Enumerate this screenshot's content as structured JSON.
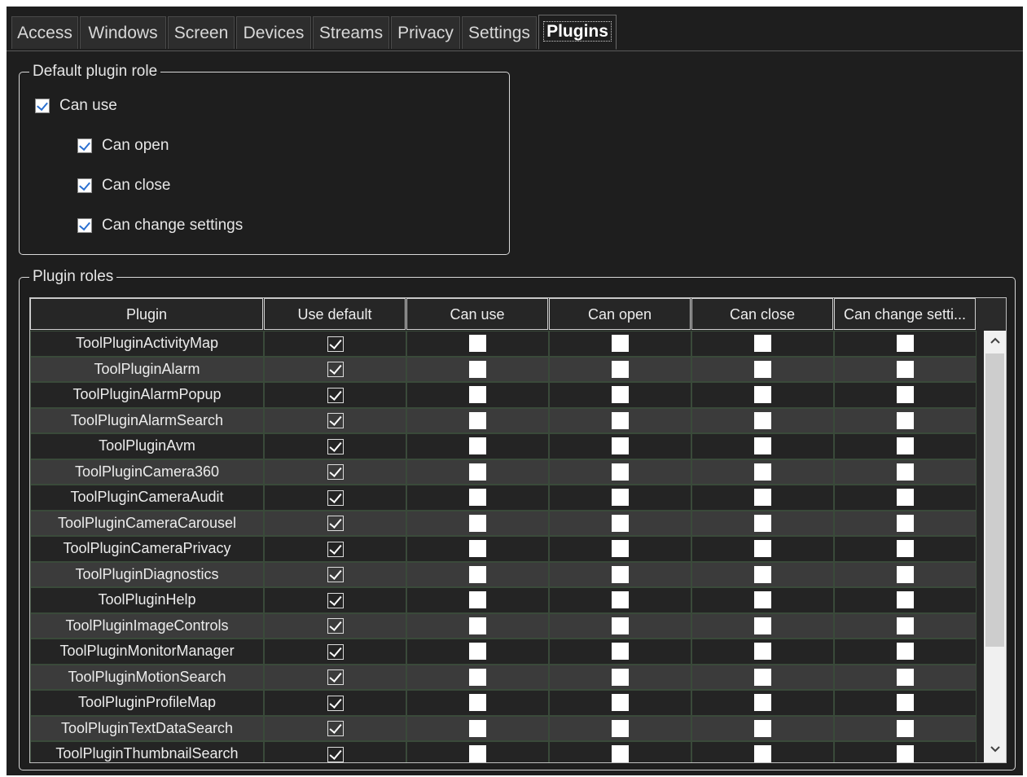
{
  "tabs": [
    {
      "label": "Access",
      "active": false
    },
    {
      "label": "Windows",
      "active": false
    },
    {
      "label": "Screen",
      "active": false
    },
    {
      "label": "Devices",
      "active": false
    },
    {
      "label": "Streams",
      "active": false
    },
    {
      "label": "Privacy",
      "active": false
    },
    {
      "label": "Settings",
      "active": false
    },
    {
      "label": "Plugins",
      "active": true
    }
  ],
  "default_role": {
    "legend": "Default plugin role",
    "can_use": {
      "label": "Can use",
      "checked": true
    },
    "can_open": {
      "label": "Can open",
      "checked": true
    },
    "can_close": {
      "label": "Can close",
      "checked": true
    },
    "can_change_settings": {
      "label": "Can change settings",
      "checked": true
    }
  },
  "plugin_roles": {
    "legend": "Plugin roles",
    "columns": [
      "Plugin",
      "Use default",
      "Can use",
      "Can open",
      "Can close",
      "Can change setti..."
    ],
    "rows": [
      {
        "plugin": "ToolPluginActivityMap",
        "use_default": true,
        "can_use": false,
        "can_open": false,
        "can_close": false,
        "can_change_settings": false
      },
      {
        "plugin": "ToolPluginAlarm",
        "use_default": true,
        "can_use": false,
        "can_open": false,
        "can_close": false,
        "can_change_settings": false
      },
      {
        "plugin": "ToolPluginAlarmPopup",
        "use_default": true,
        "can_use": false,
        "can_open": false,
        "can_close": false,
        "can_change_settings": false
      },
      {
        "plugin": "ToolPluginAlarmSearch",
        "use_default": true,
        "can_use": false,
        "can_open": false,
        "can_close": false,
        "can_change_settings": false
      },
      {
        "plugin": "ToolPluginAvm",
        "use_default": true,
        "can_use": false,
        "can_open": false,
        "can_close": false,
        "can_change_settings": false
      },
      {
        "plugin": "ToolPluginCamera360",
        "use_default": true,
        "can_use": false,
        "can_open": false,
        "can_close": false,
        "can_change_settings": false
      },
      {
        "plugin": "ToolPluginCameraAudit",
        "use_default": true,
        "can_use": false,
        "can_open": false,
        "can_close": false,
        "can_change_settings": false
      },
      {
        "plugin": "ToolPluginCameraCarousel",
        "use_default": true,
        "can_use": false,
        "can_open": false,
        "can_close": false,
        "can_change_settings": false
      },
      {
        "plugin": "ToolPluginCameraPrivacy",
        "use_default": true,
        "can_use": false,
        "can_open": false,
        "can_close": false,
        "can_change_settings": false
      },
      {
        "plugin": "ToolPluginDiagnostics",
        "use_default": true,
        "can_use": false,
        "can_open": false,
        "can_close": false,
        "can_change_settings": false
      },
      {
        "plugin": "ToolPluginHelp",
        "use_default": true,
        "can_use": false,
        "can_open": false,
        "can_close": false,
        "can_change_settings": false
      },
      {
        "plugin": "ToolPluginImageControls",
        "use_default": true,
        "can_use": false,
        "can_open": false,
        "can_close": false,
        "can_change_settings": false
      },
      {
        "plugin": "ToolPluginMonitorManager",
        "use_default": true,
        "can_use": false,
        "can_open": false,
        "can_close": false,
        "can_change_settings": false
      },
      {
        "plugin": "ToolPluginMotionSearch",
        "use_default": true,
        "can_use": false,
        "can_open": false,
        "can_close": false,
        "can_change_settings": false
      },
      {
        "plugin": "ToolPluginProfileMap",
        "use_default": true,
        "can_use": false,
        "can_open": false,
        "can_close": false,
        "can_change_settings": false
      },
      {
        "plugin": "ToolPluginTextDataSearch",
        "use_default": true,
        "can_use": false,
        "can_open": false,
        "can_close": false,
        "can_change_settings": false
      },
      {
        "plugin": "ToolPluginThumbnailSearch",
        "use_default": true,
        "can_use": false,
        "can_open": false,
        "can_close": false,
        "can_change_settings": false
      }
    ]
  },
  "scrollbar": {
    "up_icon": "chevron-up-icon",
    "down_icon": "chevron-down-icon"
  }
}
